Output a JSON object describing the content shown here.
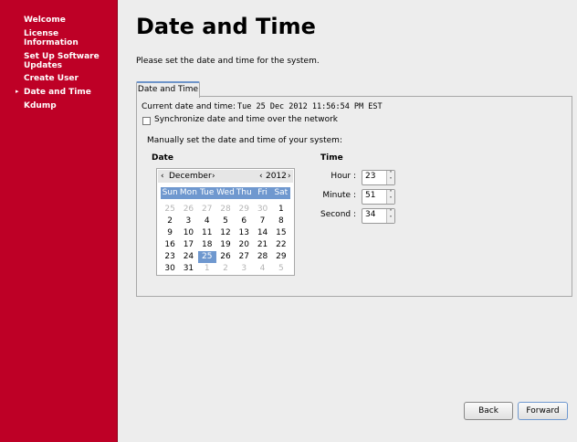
{
  "sidebar": {
    "items": [
      "Welcome",
      "License Information",
      "Set Up Software Updates",
      "Create User",
      "Date and Time",
      "Kdump"
    ],
    "active": "Date and Time"
  },
  "title": "Date and Time",
  "subtitle": "Please set the date and time for the system.",
  "tab": "Date and Time",
  "current_label": "Current date and time:",
  "current_value": "Tue 25 Dec 2012 11:56:54 PM EST",
  "sync_label": "Synchronize date and time over the network",
  "sync_checked": false,
  "manual_label": "Manually set the date and time of your system:",
  "date_heading": "Date",
  "time_heading": "Time",
  "calendar": {
    "month": "December",
    "year": "2012",
    "prev": "‹",
    "next": "›",
    "days_of_week": [
      "Sun",
      "Mon",
      "Tue",
      "Wed",
      "Thu",
      "Fri",
      "Sat"
    ],
    "weeks": [
      [
        "25",
        "26",
        "27",
        "28",
        "29",
        "30",
        "1"
      ],
      [
        "2",
        "3",
        "4",
        "5",
        "6",
        "7",
        "8"
      ],
      [
        "9",
        "10",
        "11",
        "12",
        "13",
        "14",
        "15"
      ],
      [
        "16",
        "17",
        "18",
        "19",
        "20",
        "21",
        "22"
      ],
      [
        "23",
        "24",
        "25",
        "26",
        "27",
        "28",
        "29"
      ],
      [
        "30",
        "31",
        "1",
        "2",
        "3",
        "4",
        "5"
      ]
    ],
    "selected": "25"
  },
  "time": {
    "hour_label": "Hour :",
    "hour": "23",
    "minute_label": "Minute :",
    "minute": "51",
    "second_label": "Second :",
    "second": "34"
  },
  "buttons": {
    "back": "Back",
    "forward": "Forward"
  },
  "colors": {
    "sidebar": "#be0026",
    "selection": "#6f98cf"
  }
}
